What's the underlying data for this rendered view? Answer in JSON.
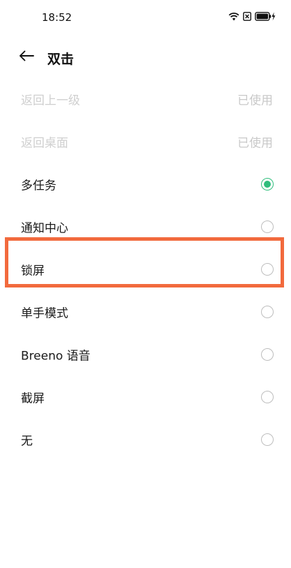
{
  "status_bar": {
    "time": "18:52"
  },
  "header": {
    "title": "双击"
  },
  "options": [
    {
      "label": "返回上一级",
      "status": "已使用",
      "disabled": true
    },
    {
      "label": "返回桌面",
      "status": "已使用",
      "disabled": true
    },
    {
      "label": "多任务",
      "selected": true
    },
    {
      "label": "通知中心",
      "selected": false
    },
    {
      "label": "锁屏",
      "selected": false
    },
    {
      "label": "单手模式",
      "selected": false
    },
    {
      "label": "Breeno 语音",
      "selected": false
    },
    {
      "label": "截屏",
      "selected": false
    },
    {
      "label": "无",
      "selected": false
    }
  ],
  "colors": {
    "accent": "#2fbd7c",
    "highlight": "#f26a3d",
    "disabled_text": "#cfcfcf"
  },
  "icons": {
    "back": "arrow-left-icon",
    "wifi": "wifi-icon",
    "sim": "no-sim-icon",
    "battery": "battery-charging-icon"
  }
}
